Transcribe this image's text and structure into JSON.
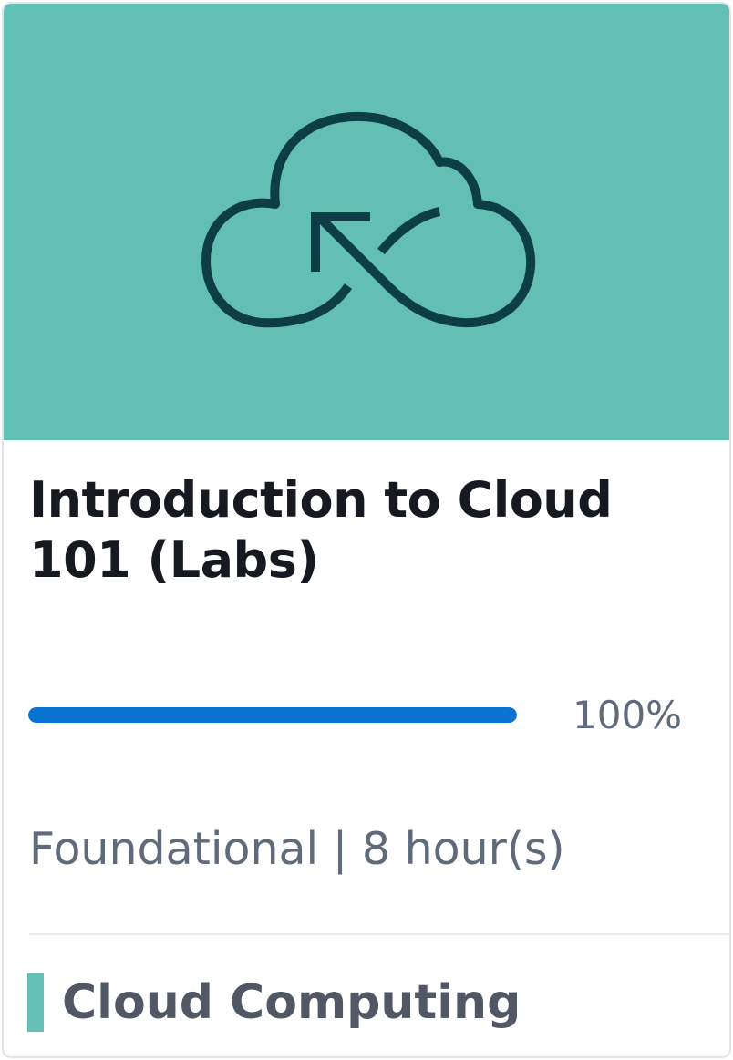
{
  "course": {
    "title": "Introduction to Cloud 101 (Labs)",
    "progress_percent": 100,
    "progress_label": "100%",
    "level": "Foundational",
    "separator": "|",
    "duration": "8 hour(s)",
    "category": "Cloud Computing"
  },
  "icons": {
    "hero": "cloud-sync-icon"
  },
  "colors": {
    "hero_background": "#63bfb4",
    "icon_stroke": "#0d3e45",
    "progress_fill": "#0972d3",
    "category_accent": "#63bfb4"
  }
}
